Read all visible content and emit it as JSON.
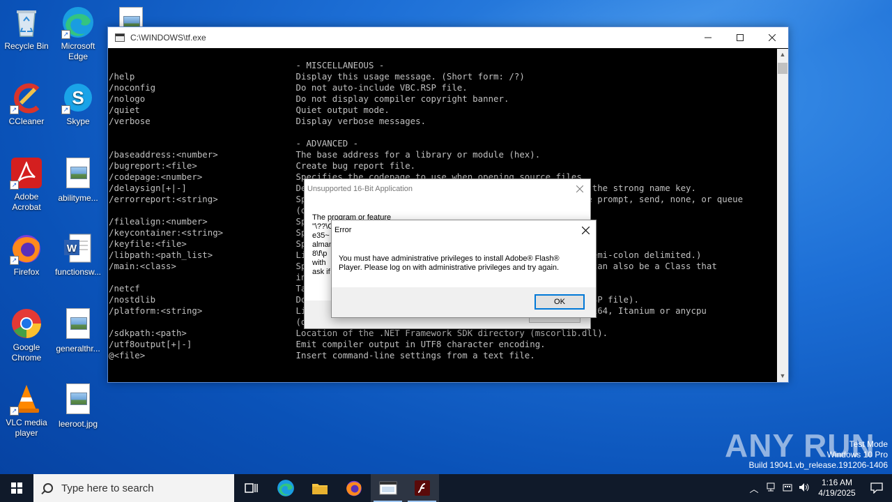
{
  "desktop": {
    "icons": [
      {
        "label": "Recycle Bin"
      },
      {
        "label": "Microsoft Edge"
      },
      {
        "label": "CCleaner"
      },
      {
        "label": "Skype"
      },
      {
        "label": "Adobe Acrobat"
      },
      {
        "label": "abilityme..."
      },
      {
        "label": "Firefox"
      },
      {
        "label": "functionsw..."
      },
      {
        "label": "Google Chrome"
      },
      {
        "label": "generalthr..."
      },
      {
        "label": "VLC media player"
      },
      {
        "label": "leeroot.jpg"
      }
    ]
  },
  "console": {
    "title": "C:\\WINDOWS\\tf.exe",
    "lines": [
      "                                    - MISCELLANEOUS -",
      "/help                               Display this usage message. (Short form: /?)",
      "/noconfig                           Do not auto-include VBC.RSP file.",
      "/nologo                             Do not display compiler copyright banner.",
      "/quiet                              Quiet output mode.",
      "/verbose                            Display verbose messages.",
      "",
      "                                    - ADVANCED -",
      "/baseaddress:<number>               The base address for a library or module (hex).",
      "/bugreport:<file>                   Create bug report file.",
      "/codepage:<number>                  Specifies the codepage to use when opening source files.",
      "/delaysign[+|-]                     Delay-sign the assembly using only the public portion of the strong name key.",
      "/errorreport:<string>               Specifies how to handle internal compiler errors; must be prompt, send, none, or queue",
      "                                    (default).",
      "/filealign:<number>                 Specify the alignment used for output file sections.",
      "/keycontainer:<string>              Specifies a strong name key container.",
      "/keyfile:<file>                     Specifies a strong name key file.",
      "/libpath:<path_list>                List of directories to search for metadata references. (Semi-colon delimited.)",
      "/main:<class>                       Specifies the Class or Module that contains Sub Main. It can also be a Class that",
      "                                    inherits from System.Windows.Forms.Form.  (Short form: /m)",
      "/netcf                              Target the .NET Compact Framework.",
      "/nostdlib                           Do not reference standard libraries (system.dll and VBC.RSP file).",
      "/platform:<string>                  Limit which platforms this code can run on; must be x86, x64, Itanium or anycpu",
      "                                    (default).",
      "/sdkpath:<path>                     Location of the .NET Framework SDK directory (mscorlib.dll).",
      "/utf8output[+|-]                    Emit compiler output in UTF8 character encoding.",
      "@<file>                             Insert command-line settings from a text file."
    ]
  },
  "dialog_16bit": {
    "title": "Unsupported 16-Bit Application",
    "text_lines": [
      "The program or feature",
      "\"\\??\\C",
      "e35~",
      "alman",
      "8\\f\\p",
      "with",
      "ask if"
    ]
  },
  "dialog_error": {
    "title": "Error",
    "message_line1": "You must have administrative privileges to install Adobe® Flash®",
    "message_line2": "Player. Please log on with administrative privileges and try again.",
    "ok_label": "OK"
  },
  "taskbar": {
    "search_placeholder": "Type here to search",
    "time": "1:16 AM",
    "date": "4/19/2025"
  },
  "watermark": {
    "line1": "Test Mode",
    "line2": "Windows 10 Pro",
    "line3": "Build 19041.vb_release.191206-1406",
    "brand": "ANY RUN"
  }
}
